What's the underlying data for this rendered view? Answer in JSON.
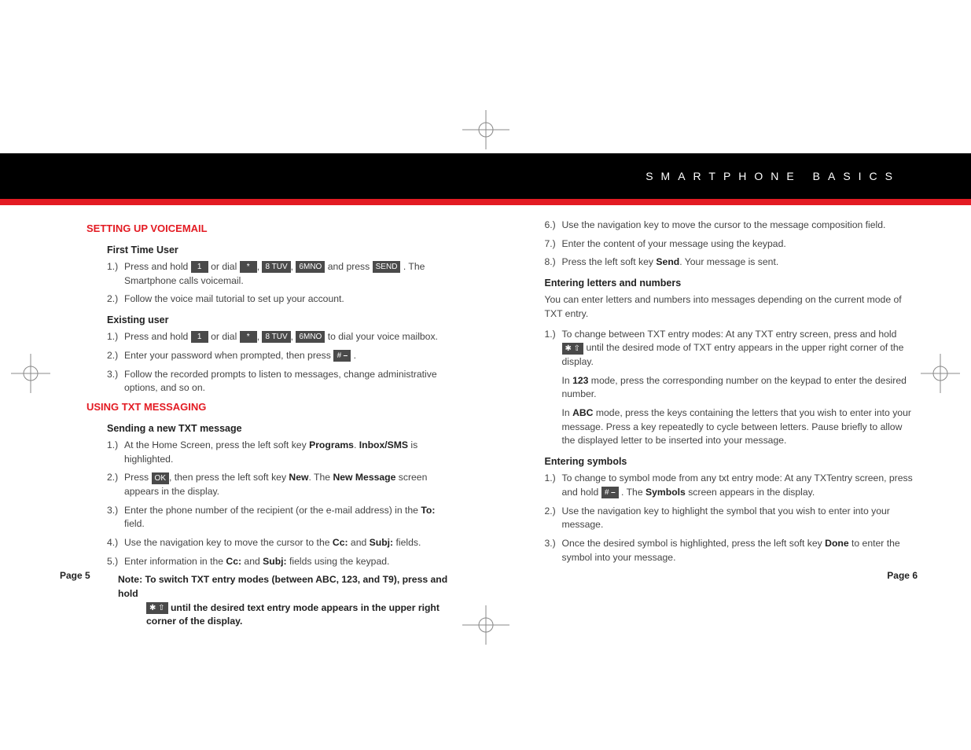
{
  "header": {
    "title": "SMARTPHONE BASICS"
  },
  "page_left": "Page 5",
  "page_right": "Page 6",
  "left": {
    "section1": {
      "title": "SETTING UP VOICEMAIL",
      "first_time": {
        "heading": "First Time User",
        "s1a": "1.)",
        "s1b_pre": "Press and hold ",
        "s1b_mid1": " or dial ",
        "s1b_mid2": ", ",
        "s1b_mid3": ", ",
        "s1b_mid4": " and press ",
        "s1b_post": ". The Smartphone calls voicemail.",
        "s2a": "2.)",
        "s2b": "Follow the voice mail tutorial to set up your account."
      },
      "existing": {
        "heading": "Existing user",
        "s1a": "1.)",
        "s1b_pre": "Press and hold ",
        "s1b_mid1": " or dial ",
        "s1b_mid2": ", ",
        "s1b_mid3": ", ",
        "s1b_post": " to dial your voice mailbox.",
        "s2a": "2.)",
        "s2b_pre": "Enter your password when prompted, then press ",
        "s2b_post": ".",
        "s3a": "3.)",
        "s3b": "Follow the recorded prompts to listen to messages, change administrative options, and so on."
      }
    },
    "section2": {
      "title": "USING TXT MESSAGING",
      "sending": {
        "heading": "Sending a new TXT message",
        "s1a": "1.)",
        "s1b_pre": "At the Home Screen, press the left soft key ",
        "s1b_b1": "Programs",
        "s1b_mid": ". ",
        "s1b_b2": "Inbox/SMS",
        "s1b_post": " is highlighted.",
        "s2a": "2.)",
        "s2b_pre": "Press ",
        "s2b_mid1": ", then press the left soft key ",
        "s2b_b1": "New",
        "s2b_mid2": ". The ",
        "s2b_b2": "New Message",
        "s2b_post": " screen appears in the display.",
        "s3a": "3.)",
        "s3b_pre": "Enter the phone number of the recipient (or the e-mail address) in the ",
        "s3b_b1": "To:",
        "s3b_post": " field.",
        "s4a": "4.)",
        "s4b_pre": "Use the navigation key to move the cursor to the ",
        "s4b_b1": "Cc:",
        "s4b_mid": " and ",
        "s4b_b2": "Subj:",
        "s4b_post": " fields.",
        "s5a": "5.)",
        "s5b_pre": "Enter information in the ",
        "s5b_b1": "Cc:",
        "s5b_mid": " and ",
        "s5b_b2": "Subj:",
        "s5b_post": " fields using the keypad.",
        "note_label": "Note: ",
        "note_line1": "To switch TXT entry modes (between ABC, 123, and T9), press and hold",
        "note_line2_post": " until the desired text entry mode appears in the upper right corner of the display."
      }
    }
  },
  "right": {
    "s6a": "6.)",
    "s6b": "Use the navigation key to move the cursor to the message composition field.",
    "s7a": "7.)",
    "s7b": "Enter the content of your message using the keypad.",
    "s8a": "8.)",
    "s8b_pre": "Press the left soft key ",
    "s8b_b1": "Send",
    "s8b_post": ". Your message is sent.",
    "letters": {
      "heading": "Entering letters and numbers",
      "intro": "You can enter letters and numbers into messages depending on the current mode of TXT entry.",
      "s1a": "1.)",
      "s1b_pre": "To change between TXT entry modes:  At any TXT entry screen, press and hold ",
      "s1b_post": " until the desired mode of TXT entry appears in the upper right corner of the display.",
      "p123_pre": "In ",
      "p123_b": "123",
      "p123_post": " mode, press the corresponding number on the keypad to enter the desired number.",
      "pabc_pre": "In ",
      "pabc_b": "ABC",
      "pabc_post": " mode, press the keys containing the letters that you wish to enter into your message. Press a key repeatedly to cycle between letters. Pause briefly to allow the displayed letter to be inserted into your message."
    },
    "symbols": {
      "heading": "Entering symbols",
      "s1a": "1.)",
      "s1b_pre": "To change to symbol mode from any txt entry mode: At any TXTentry screen, press and hold ",
      "s1b_mid": ". The ",
      "s1b_b1": "Symbols",
      "s1b_post": " screen appears in the display.",
      "s2a": "2.)",
      "s2b": "Use the navigation key to highlight the symbol that you wish to enter into your message.",
      "s3a": "3.)",
      "s3b_pre": "Once the desired symbol is highlighted, press the left soft key ",
      "s3b_b1": "Done",
      "s3b_post": " to enter the symbol into your message."
    }
  },
  "keys": {
    "one": "1",
    "star": "*",
    "eight": "8 TUV",
    "six": "6MNO",
    "send": "SEND",
    "hash": "# ⎯",
    "ok": "OK",
    "starshift": "✱ ⇧"
  }
}
